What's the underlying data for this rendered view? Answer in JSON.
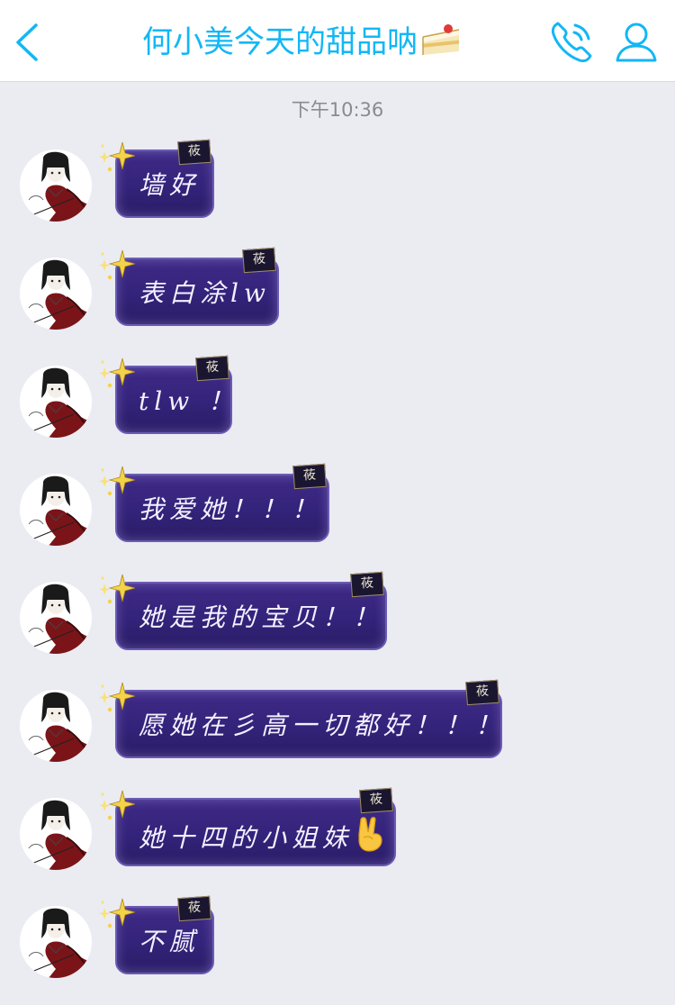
{
  "header": {
    "title": "何小美今天的甜品呐",
    "title_color": "#12b7f5"
  },
  "timestamp": "下午10:36",
  "bubble_tag": "莜",
  "messages": [
    {
      "text": "墙好"
    },
    {
      "text": "表白涂lw"
    },
    {
      "text": "tlw ！"
    },
    {
      "text": "我爱她！！！"
    },
    {
      "text": "她是我的宝贝！！"
    },
    {
      "text": "愿她在彡高一切都好！！！"
    },
    {
      "text": "她十四的小姐妹",
      "emoji": "victory-hand"
    },
    {
      "text": "不腻"
    }
  ],
  "colors": {
    "bubble": "#34237a",
    "bubble_border": "#6a5cb4",
    "background": "#ebebf2",
    "icon_blue": "#12b7f5"
  }
}
